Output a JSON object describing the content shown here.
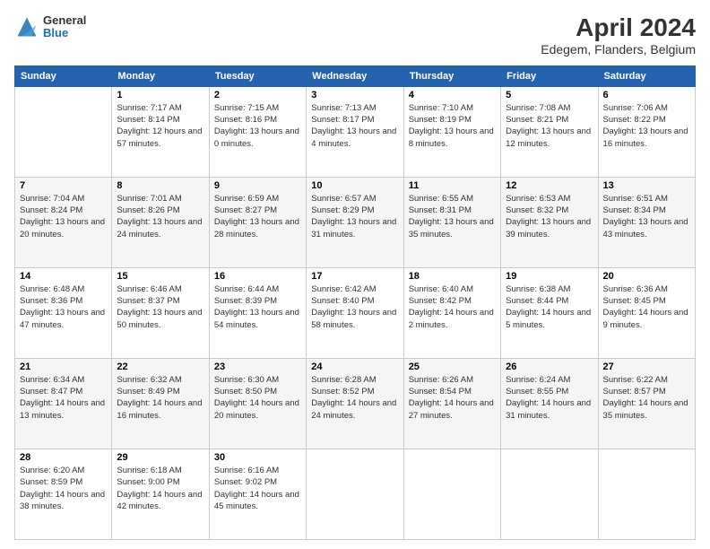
{
  "header": {
    "logo": {
      "line1": "General",
      "line2": "Blue"
    },
    "title": "April 2024",
    "subtitle": "Edegem, Flanders, Belgium"
  },
  "weekdays": [
    "Sunday",
    "Monday",
    "Tuesday",
    "Wednesday",
    "Thursday",
    "Friday",
    "Saturday"
  ],
  "weeks": [
    [
      {
        "day": "",
        "sunrise": "",
        "sunset": "",
        "daylight": ""
      },
      {
        "day": "1",
        "sunrise": "Sunrise: 7:17 AM",
        "sunset": "Sunset: 8:14 PM",
        "daylight": "Daylight: 12 hours and 57 minutes."
      },
      {
        "day": "2",
        "sunrise": "Sunrise: 7:15 AM",
        "sunset": "Sunset: 8:16 PM",
        "daylight": "Daylight: 13 hours and 0 minutes."
      },
      {
        "day": "3",
        "sunrise": "Sunrise: 7:13 AM",
        "sunset": "Sunset: 8:17 PM",
        "daylight": "Daylight: 13 hours and 4 minutes."
      },
      {
        "day": "4",
        "sunrise": "Sunrise: 7:10 AM",
        "sunset": "Sunset: 8:19 PM",
        "daylight": "Daylight: 13 hours and 8 minutes."
      },
      {
        "day": "5",
        "sunrise": "Sunrise: 7:08 AM",
        "sunset": "Sunset: 8:21 PM",
        "daylight": "Daylight: 13 hours and 12 minutes."
      },
      {
        "day": "6",
        "sunrise": "Sunrise: 7:06 AM",
        "sunset": "Sunset: 8:22 PM",
        "daylight": "Daylight: 13 hours and 16 minutes."
      }
    ],
    [
      {
        "day": "7",
        "sunrise": "Sunrise: 7:04 AM",
        "sunset": "Sunset: 8:24 PM",
        "daylight": "Daylight: 13 hours and 20 minutes."
      },
      {
        "day": "8",
        "sunrise": "Sunrise: 7:01 AM",
        "sunset": "Sunset: 8:26 PM",
        "daylight": "Daylight: 13 hours and 24 minutes."
      },
      {
        "day": "9",
        "sunrise": "Sunrise: 6:59 AM",
        "sunset": "Sunset: 8:27 PM",
        "daylight": "Daylight: 13 hours and 28 minutes."
      },
      {
        "day": "10",
        "sunrise": "Sunrise: 6:57 AM",
        "sunset": "Sunset: 8:29 PM",
        "daylight": "Daylight: 13 hours and 31 minutes."
      },
      {
        "day": "11",
        "sunrise": "Sunrise: 6:55 AM",
        "sunset": "Sunset: 8:31 PM",
        "daylight": "Daylight: 13 hours and 35 minutes."
      },
      {
        "day": "12",
        "sunrise": "Sunrise: 6:53 AM",
        "sunset": "Sunset: 8:32 PM",
        "daylight": "Daylight: 13 hours and 39 minutes."
      },
      {
        "day": "13",
        "sunrise": "Sunrise: 6:51 AM",
        "sunset": "Sunset: 8:34 PM",
        "daylight": "Daylight: 13 hours and 43 minutes."
      }
    ],
    [
      {
        "day": "14",
        "sunrise": "Sunrise: 6:48 AM",
        "sunset": "Sunset: 8:36 PM",
        "daylight": "Daylight: 13 hours and 47 minutes."
      },
      {
        "day": "15",
        "sunrise": "Sunrise: 6:46 AM",
        "sunset": "Sunset: 8:37 PM",
        "daylight": "Daylight: 13 hours and 50 minutes."
      },
      {
        "day": "16",
        "sunrise": "Sunrise: 6:44 AM",
        "sunset": "Sunset: 8:39 PM",
        "daylight": "Daylight: 13 hours and 54 minutes."
      },
      {
        "day": "17",
        "sunrise": "Sunrise: 6:42 AM",
        "sunset": "Sunset: 8:40 PM",
        "daylight": "Daylight: 13 hours and 58 minutes."
      },
      {
        "day": "18",
        "sunrise": "Sunrise: 6:40 AM",
        "sunset": "Sunset: 8:42 PM",
        "daylight": "Daylight: 14 hours and 2 minutes."
      },
      {
        "day": "19",
        "sunrise": "Sunrise: 6:38 AM",
        "sunset": "Sunset: 8:44 PM",
        "daylight": "Daylight: 14 hours and 5 minutes."
      },
      {
        "day": "20",
        "sunrise": "Sunrise: 6:36 AM",
        "sunset": "Sunset: 8:45 PM",
        "daylight": "Daylight: 14 hours and 9 minutes."
      }
    ],
    [
      {
        "day": "21",
        "sunrise": "Sunrise: 6:34 AM",
        "sunset": "Sunset: 8:47 PM",
        "daylight": "Daylight: 14 hours and 13 minutes."
      },
      {
        "day": "22",
        "sunrise": "Sunrise: 6:32 AM",
        "sunset": "Sunset: 8:49 PM",
        "daylight": "Daylight: 14 hours and 16 minutes."
      },
      {
        "day": "23",
        "sunrise": "Sunrise: 6:30 AM",
        "sunset": "Sunset: 8:50 PM",
        "daylight": "Daylight: 14 hours and 20 minutes."
      },
      {
        "day": "24",
        "sunrise": "Sunrise: 6:28 AM",
        "sunset": "Sunset: 8:52 PM",
        "daylight": "Daylight: 14 hours and 24 minutes."
      },
      {
        "day": "25",
        "sunrise": "Sunrise: 6:26 AM",
        "sunset": "Sunset: 8:54 PM",
        "daylight": "Daylight: 14 hours and 27 minutes."
      },
      {
        "day": "26",
        "sunrise": "Sunrise: 6:24 AM",
        "sunset": "Sunset: 8:55 PM",
        "daylight": "Daylight: 14 hours and 31 minutes."
      },
      {
        "day": "27",
        "sunrise": "Sunrise: 6:22 AM",
        "sunset": "Sunset: 8:57 PM",
        "daylight": "Daylight: 14 hours and 35 minutes."
      }
    ],
    [
      {
        "day": "28",
        "sunrise": "Sunrise: 6:20 AM",
        "sunset": "Sunset: 8:59 PM",
        "daylight": "Daylight: 14 hours and 38 minutes."
      },
      {
        "day": "29",
        "sunrise": "Sunrise: 6:18 AM",
        "sunset": "Sunset: 9:00 PM",
        "daylight": "Daylight: 14 hours and 42 minutes."
      },
      {
        "day": "30",
        "sunrise": "Sunrise: 6:16 AM",
        "sunset": "Sunset: 9:02 PM",
        "daylight": "Daylight: 14 hours and 45 minutes."
      },
      {
        "day": "",
        "sunrise": "",
        "sunset": "",
        "daylight": ""
      },
      {
        "day": "",
        "sunrise": "",
        "sunset": "",
        "daylight": ""
      },
      {
        "day": "",
        "sunrise": "",
        "sunset": "",
        "daylight": ""
      },
      {
        "day": "",
        "sunrise": "",
        "sunset": "",
        "daylight": ""
      }
    ]
  ]
}
